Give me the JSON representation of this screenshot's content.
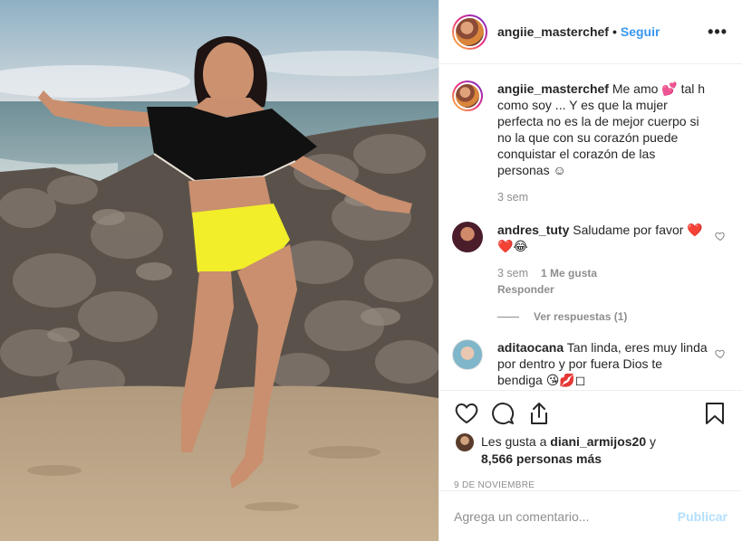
{
  "post": {
    "author": "angiie_masterchef",
    "separator": "•",
    "follow_label": "Seguir",
    "more_label": "•••"
  },
  "comments": [
    {
      "username": "angiie_masterchef",
      "text": "Me amo 💕 tal h como soy ... Y es que la mujer perfecta no es la de mejor cuerpo si no la que con su corazón puede conquistar el corazón de las personas ☺",
      "time": "3 sem"
    },
    {
      "username": "andres_tuty",
      "text": "Saludame por favor ❤️❤️😂",
      "time": "3 sem",
      "likes": "1 Me gusta",
      "reply_label": "Responder",
      "view_replies": "Ver respuestas (1)"
    },
    {
      "username": "aditaocana",
      "text": "Tan linda, eres muy linda por dentro y por fuera Dios te bendiga 😘💋◻"
    }
  ],
  "likes": {
    "prefix": "Les gusta a",
    "user": "diani_armijos20",
    "conjunction": "y",
    "others": "8,566 personas más"
  },
  "date": "9 de noviembre",
  "add_comment": {
    "placeholder": "Agrega un comentario...",
    "publish_label": "Publicar"
  },
  "colors": {
    "link": "#3897f0",
    "muted": "#8e8e8e",
    "publish_disabled": "#b2dffc",
    "bikini_top": "#111111",
    "bikini_bottom": "#f2ee2a"
  },
  "icons": [
    "heart-icon",
    "comment-icon",
    "share-icon",
    "bookmark-icon",
    "more-icon"
  ]
}
